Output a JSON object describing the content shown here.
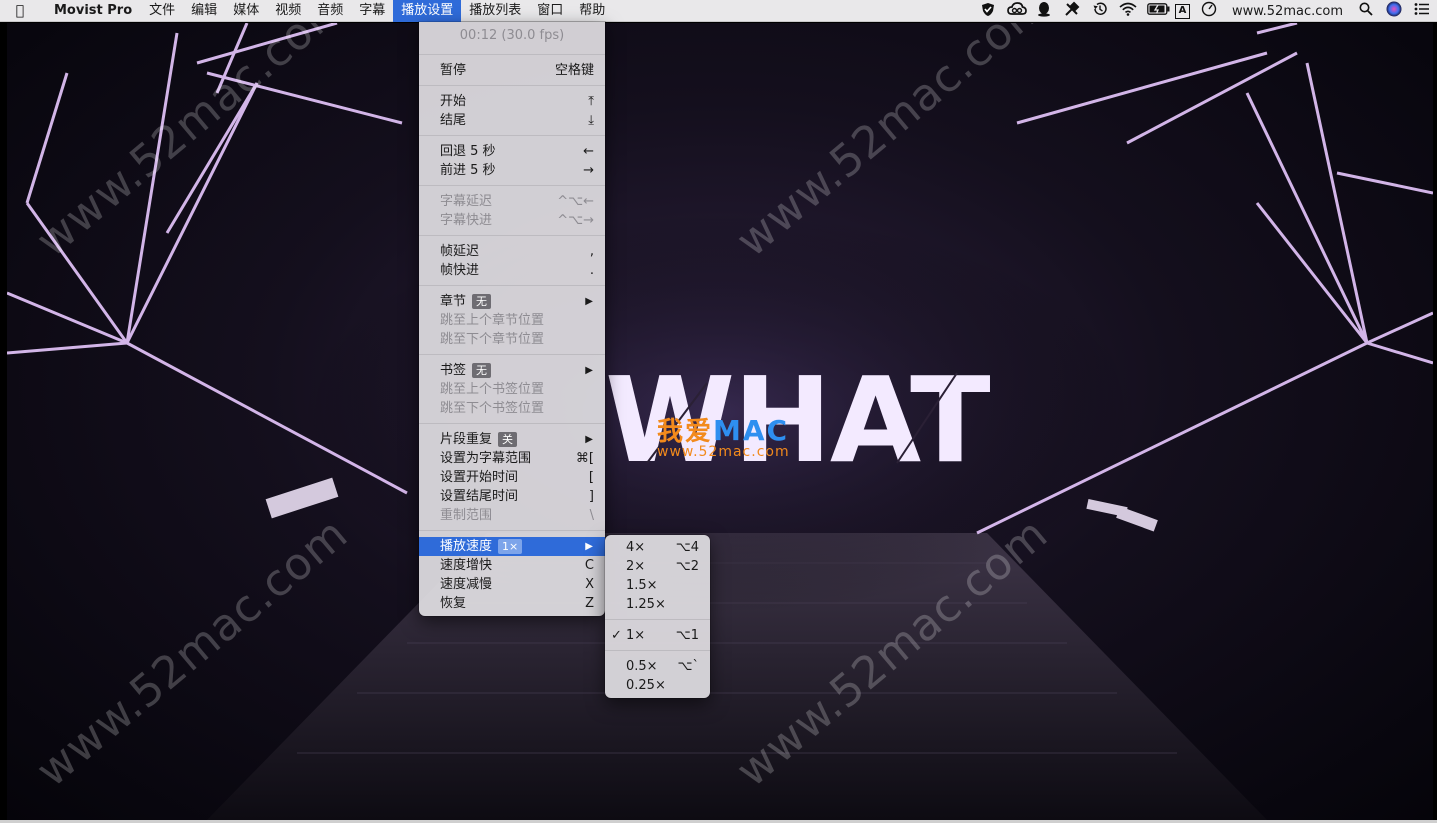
{
  "menubar": {
    "app_name": "Movist Pro",
    "menus": [
      "文件",
      "编辑",
      "媒体",
      "视频",
      "音频",
      "字幕",
      "播放设置",
      "播放列表",
      "窗口",
      "帮助"
    ],
    "active_menu": "播放设置",
    "status_url": "www.52mac.com",
    "status_icons": [
      "shield-check-icon",
      "creative-cloud-icon",
      "qq-icon",
      "tools-icon",
      "time-machine-icon",
      "wifi-icon",
      "battery-icon",
      "input-source-icon",
      "clock-icon",
      "search-icon",
      "siri-icon",
      "notification-center-icon"
    ],
    "input_source_letter": "A"
  },
  "video": {
    "title_text": "WHAT",
    "logo_cn": "我爱",
    "logo_en": "MAC",
    "logo_site": "www.52mac.com",
    "watermark": "www.52mac.com"
  },
  "play_menu": {
    "header": "00:12 (30.0 fps)",
    "pause": {
      "label": "暂停",
      "shortcut": "空格键"
    },
    "begin": {
      "label": "开始",
      "shortcut": "⤒"
    },
    "end": {
      "label": "结尾",
      "shortcut": "⤓"
    },
    "rewind": {
      "label": "回退 5 秒",
      "shortcut": "←"
    },
    "forward": {
      "label": "前进 5 秒",
      "shortcut": "→"
    },
    "sub_delay": {
      "label": "字幕延迟",
      "shortcut": "^⌥←"
    },
    "sub_advance": {
      "label": "字幕快进",
      "shortcut": "^⌥→"
    },
    "frame_delay": {
      "label": "帧延迟",
      "shortcut": ","
    },
    "frame_advance": {
      "label": "帧快进",
      "shortcut": "."
    },
    "chapter": {
      "label": "章节",
      "badge": "无"
    },
    "prev_chapter": {
      "label": "跳至上个章节位置"
    },
    "next_chapter": {
      "label": "跳至下个章节位置"
    },
    "bookmark": {
      "label": "书签",
      "badge": "无"
    },
    "prev_bookmark": {
      "label": "跳至上个书签位置"
    },
    "next_bookmark": {
      "label": "跳至下个书签位置"
    },
    "ab_repeat": {
      "label": "片段重复",
      "badge": "关"
    },
    "set_sub_range": {
      "label": "设置为字幕范围",
      "shortcut": "⌘["
    },
    "set_start": {
      "label": "设置开始时间",
      "shortcut": "["
    },
    "set_end": {
      "label": "设置结尾时间",
      "shortcut": "]"
    },
    "reset_range": {
      "label": "重制范围",
      "shortcut": "\\"
    },
    "speed": {
      "label": "播放速度",
      "badge": "1×"
    },
    "speed_up": {
      "label": "速度增快",
      "shortcut": "C"
    },
    "speed_down": {
      "label": "速度减慢",
      "shortcut": "X"
    },
    "restore": {
      "label": "恢复",
      "shortcut": "Z"
    }
  },
  "speed_menu": {
    "items": [
      {
        "label": "4×",
        "shortcut": "⌥4"
      },
      {
        "label": "2×",
        "shortcut": "⌥2"
      },
      {
        "label": "1.5×",
        "shortcut": ""
      },
      {
        "label": "1.25×",
        "shortcut": ""
      },
      {
        "label": "1×",
        "shortcut": "⌥1",
        "checked": true
      },
      {
        "label": "0.5×",
        "shortcut": "⌥`"
      },
      {
        "label": "0.25×",
        "shortcut": ""
      }
    ],
    "check_mark": "✓"
  }
}
